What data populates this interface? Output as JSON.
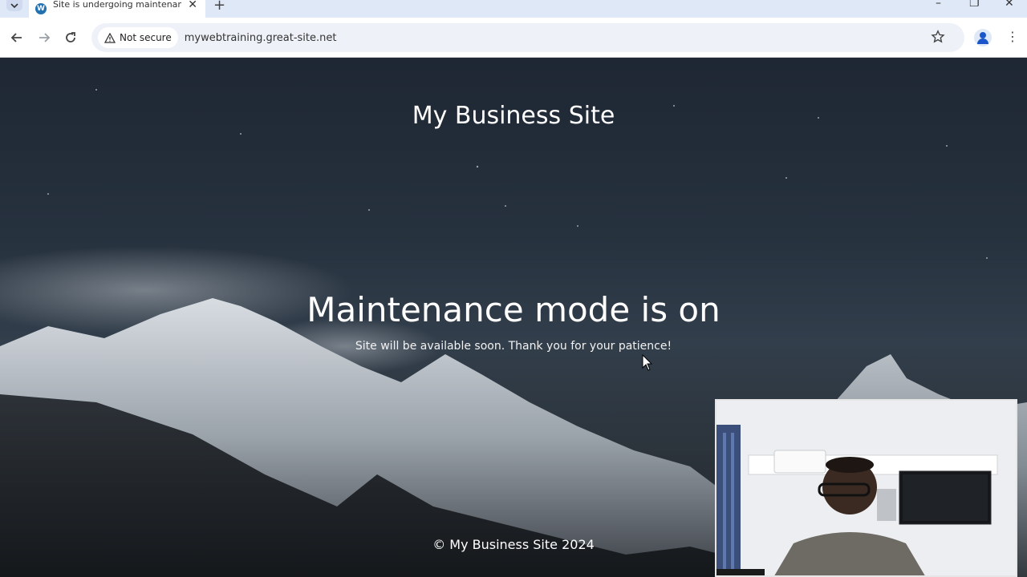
{
  "browser": {
    "tab_title": "Site is undergoing maintenance",
    "tab_close": "✕",
    "new_tab": "+",
    "security_label": "Not secure",
    "url": "mywebtraining.great-site.net",
    "window_controls": [
      "–",
      "❐",
      "✕"
    ],
    "favicon_letter": "W"
  },
  "page": {
    "site_title": "My Business Site",
    "headline": "Maintenance mode is on",
    "message": "Site will be available soon. Thank you for your patience!",
    "footer": "© My Business Site 2024"
  },
  "colors": {
    "tab_strip": "#dfe8f7",
    "profile_accent": "#1a56c9",
    "text": "#ffffff"
  }
}
